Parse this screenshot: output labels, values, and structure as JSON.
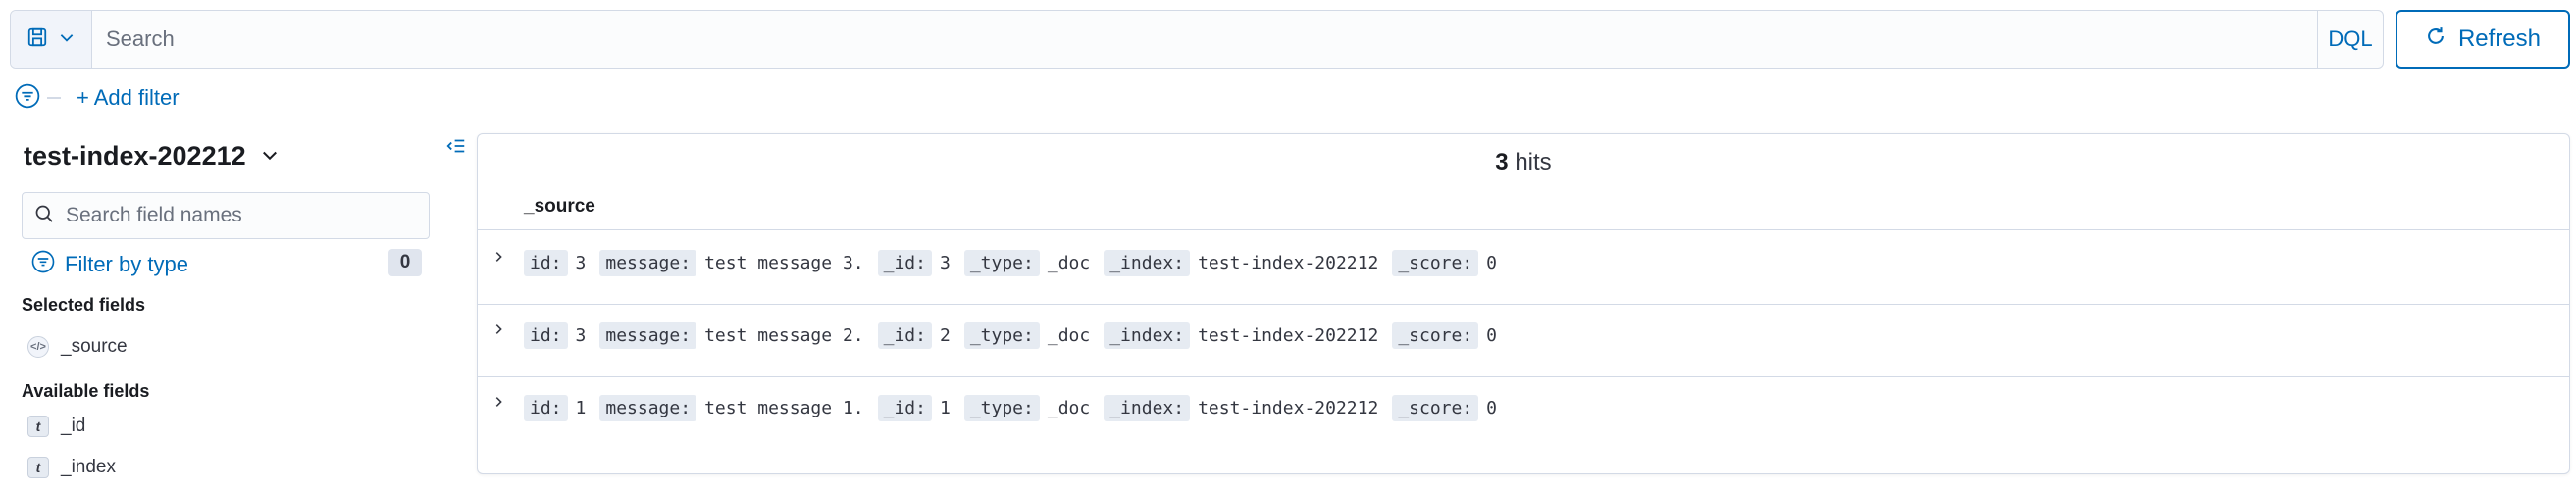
{
  "search": {
    "placeholder": "Search",
    "language": "DQL",
    "refresh_label": "Refresh"
  },
  "filter_bar": {
    "add_filter_label": "+ Add filter"
  },
  "sidebar": {
    "index_pattern": "test-index-202212",
    "field_search_placeholder": "Search field names",
    "filter_by_type_label": "Filter by type",
    "filter_count": "0",
    "selected_title": "Selected fields",
    "selected_fields": [
      {
        "name": "_source",
        "type_icon": "code-icon"
      }
    ],
    "available_title": "Available fields",
    "available_fields": [
      {
        "name": "_id",
        "type_token": "t"
      },
      {
        "name": "_index",
        "type_token": "t"
      }
    ]
  },
  "results": {
    "hits_count": "3",
    "hits_label": "hits",
    "column_header": "_source",
    "rows": [
      {
        "id": "3",
        "message": "test message 3.",
        "_id": "3",
        "_type": "_doc",
        "_index": "test-index-202212",
        "_score": "0"
      },
      {
        "id": "3",
        "message": "test message 2.",
        "_id": "2",
        "_type": "_doc",
        "_index": "test-index-202212",
        "_score": "0"
      },
      {
        "id": "1",
        "message": "test message 1.",
        "_id": "1",
        "_type": "_doc",
        "_index": "test-index-202212",
        "_score": "0"
      }
    ],
    "keys": {
      "id": "id:",
      "message": "message:",
      "_id": "_id:",
      "_type": "_type:",
      "_index": "_index:",
      "_score": "_score:"
    }
  },
  "colors": {
    "accent": "#006bb8",
    "border": "#d3dae6",
    "text": "#343741"
  }
}
